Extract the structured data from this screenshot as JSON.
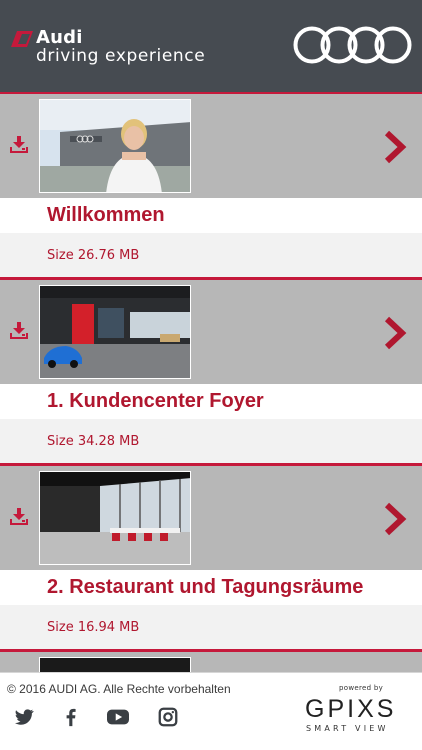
{
  "header": {
    "brand_name": "Audi",
    "brand_sub": "driving experience",
    "brand_color": "#464b51",
    "accent_color": "#c5193b"
  },
  "items": [
    {
      "title": "Willkommen",
      "size": "Size 26.76 MB",
      "download_icon": "download-icon",
      "open_icon": "chevron-right-icon"
    },
    {
      "title": "1. Kundencenter Foyer",
      "size": "Size 34.28 MB",
      "download_icon": "download-icon",
      "open_icon": "chevron-right-icon"
    },
    {
      "title": "2. Restaurant und Tagungsräume",
      "size": "Size 16.94 MB",
      "download_icon": "download-icon",
      "open_icon": "chevron-right-icon"
    }
  ],
  "footer": {
    "copyright": "© 2016 AUDI AG. Alle Rechte vorbehalten",
    "powered_by": "powered by",
    "partner_logo": "GPIXS",
    "partner_tagline": "SMART VIEW",
    "social_icons": [
      "twitter-icon",
      "facebook-icon",
      "youtube-icon",
      "instagram-icon"
    ]
  }
}
